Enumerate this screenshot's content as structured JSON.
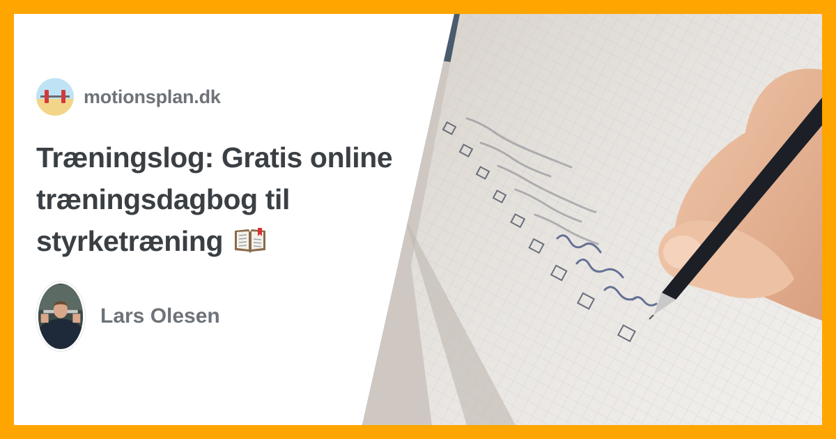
{
  "site": {
    "name": "motionsplan.dk",
    "logo_icon": "barbell-icon"
  },
  "article": {
    "title": "Træningslog: Gratis online træningsdagbog til styrketræning",
    "title_icon": "open-book-icon"
  },
  "author": {
    "name": "Lars Olesen",
    "avatar_icon": "author-photo"
  },
  "hero_image": {
    "icon": "checklist-notebook-photo"
  },
  "colors": {
    "border": "#ffa500",
    "text_dark": "#3a3f44",
    "text_muted": "#6d7378"
  }
}
